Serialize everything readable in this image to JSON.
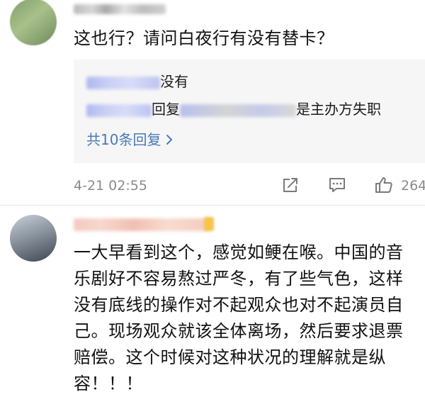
{
  "comments": [
    {
      "text": "这也行？请问白夜行有没有替卡？",
      "replies": [
        {
          "suffix": "没有"
        },
        {
          "middle": "回复",
          "suffix": "是主办方失职"
        }
      ],
      "more_replies": "共10条回复",
      "timestamp": "4-21 02:55",
      "like_count": "264"
    },
    {
      "text": "一大早看到这个，感觉如鲠在喉。中国的音乐剧好不容易熬过严冬，有了些气色，这样没有底线的操作对不起观众也对不起演员自己。现场观众就该全体离场，然后要求退票赔偿。这个时候对这种状况的理解就是纵容！！！"
    }
  ],
  "colors": {
    "link": "#4a79b8",
    "meta": "#8a8a8a",
    "reply_bg": "#f6f6f6"
  },
  "icons": [
    "share-icon",
    "comment-icon",
    "like-icon",
    "chevron-right-icon"
  ]
}
